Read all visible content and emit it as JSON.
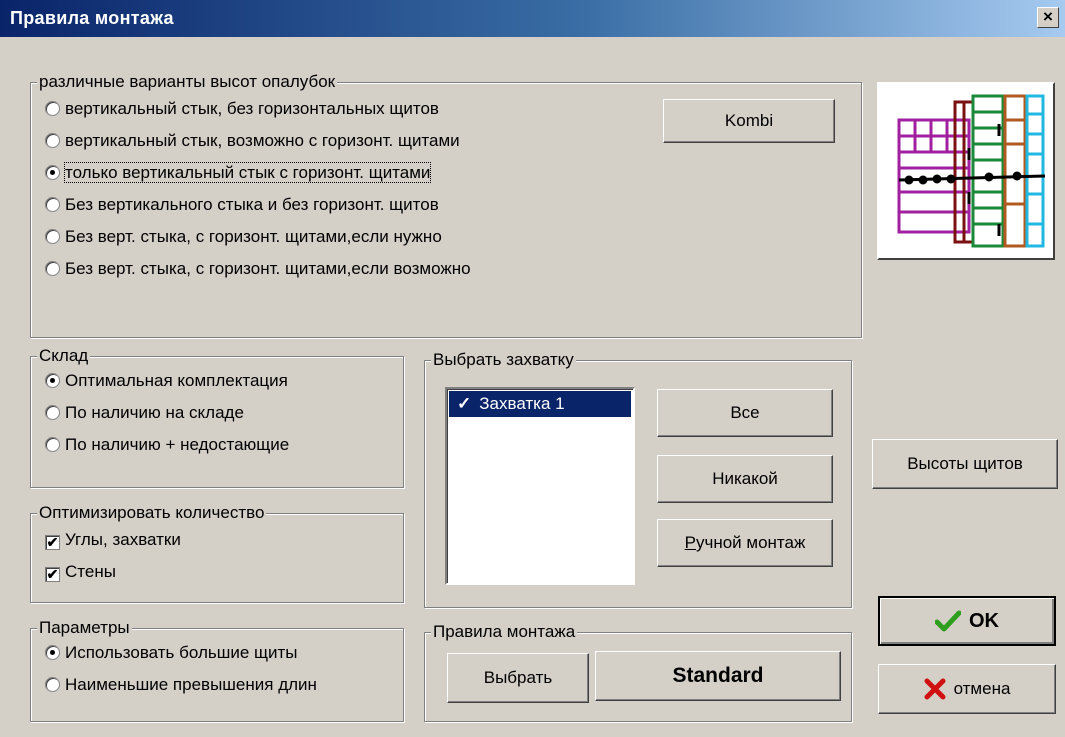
{
  "window": {
    "title": "Правила монтажа",
    "close_glyph": "×"
  },
  "heights_group": {
    "legend": "различные варианты высот опалубок",
    "options": [
      {
        "label": "вертикальный стык, без горизонтальных щитов",
        "selected": false
      },
      {
        "label": "вертикальный стык, возможно с горизонт. щитами",
        "selected": false
      },
      {
        "label": "только вертикальный  стык с горизонт.  щитами",
        "selected": true
      },
      {
        "label": "Без вертикального стыка и без горизонт. щитов",
        "selected": false
      },
      {
        "label": "Без верт. стыка, с горизонт. щитами,если нужно",
        "selected": false
      },
      {
        "label": "Без верт. стыка, с горизонт. щитами,если возможно",
        "selected": false
      }
    ],
    "kombi_label": "Kombi"
  },
  "sklad": {
    "legend": "Склад",
    "options": [
      {
        "label": "Оптимальная комплектация",
        "selected": true
      },
      {
        "label": "По наличию на складе",
        "selected": false
      },
      {
        "label": "По наличию + недостающие",
        "selected": false
      }
    ]
  },
  "optimize": {
    "legend": "Оптимизировать количество",
    "checks": [
      {
        "label": "Углы, захватки",
        "checked": true
      },
      {
        "label": "Стены",
        "checked": true
      }
    ]
  },
  "params": {
    "legend": "Параметры",
    "options": [
      {
        "label": "Использовать большие щиты",
        "selected": true
      },
      {
        "label": "Наименьшие превышения длин",
        "selected": false
      }
    ]
  },
  "zahvatka": {
    "legend": "Выбрать захватку",
    "items": [
      {
        "label": "Захватка 1",
        "checked": true
      }
    ],
    "check_glyph": "✓",
    "btn_all": "Все",
    "btn_none": "Никакой",
    "btn_manual_underline": "Р",
    "btn_manual_rest": "учной монтаж"
  },
  "rules": {
    "legend": "Правила монтажа",
    "btn_choose": "Выбрать",
    "current_value": "Standard"
  },
  "right_panel": {
    "btn_heights": "Высоты щитов",
    "btn_ok": "OK",
    "btn_cancel": "отмена",
    "ok_icon_color": "#2e9e1f",
    "cancel_icon_color": "#d01010"
  }
}
